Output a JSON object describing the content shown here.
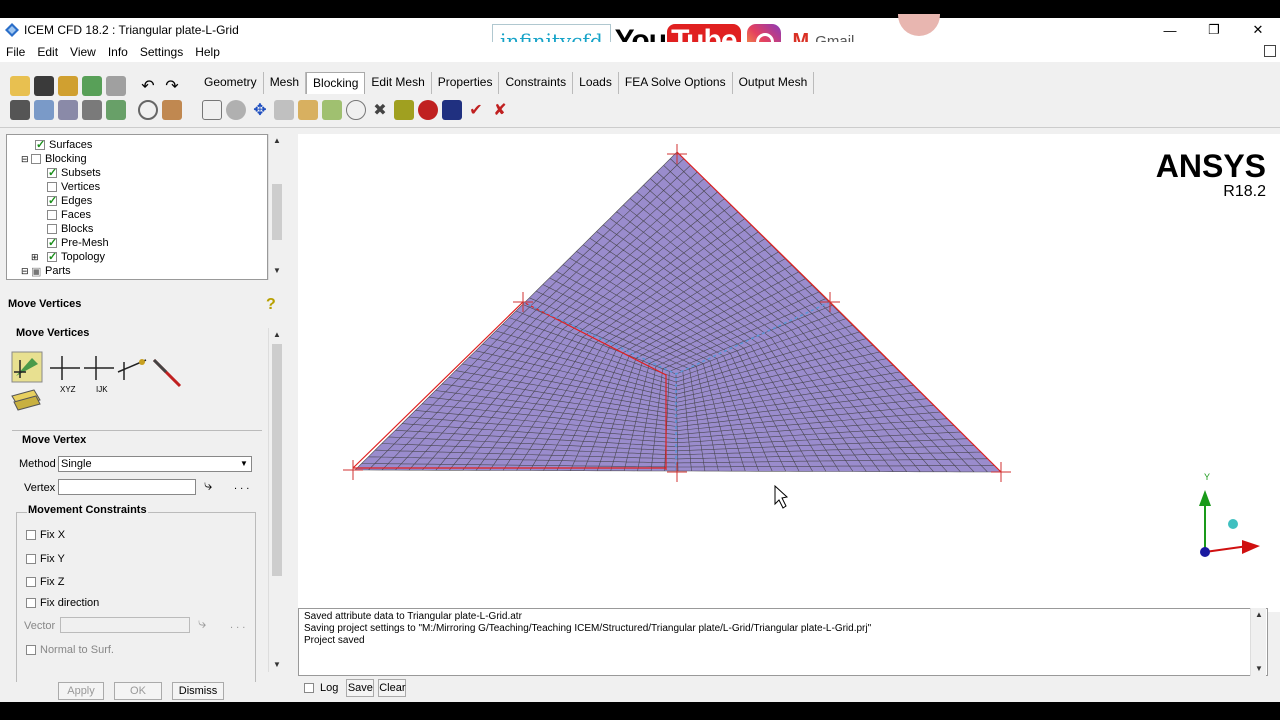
{
  "window": {
    "title": "ICEM CFD 18.2 : Triangular plate-L-Grid",
    "controls": [
      "minimize-icon",
      "restore-icon",
      "close-icon"
    ]
  },
  "branding": {
    "site": "infinitycfd",
    "youtube_you": "You",
    "youtube_tube": "Tube",
    "gmail": "Gmail"
  },
  "menu": [
    "File",
    "Edit",
    "View",
    "Info",
    "Settings",
    "Help"
  ],
  "tabs": [
    "Geometry",
    "Mesh",
    "Blocking",
    "Edit Mesh",
    "Properties",
    "Constraints",
    "Loads",
    "FEA Solve Options",
    "Output Mesh"
  ],
  "active_tab": "Blocking",
  "tree": [
    {
      "label": "Surfaces",
      "checked": true,
      "indent": 2
    },
    {
      "label": "Blocking",
      "checked": false,
      "indent": 1,
      "expander": "-"
    },
    {
      "label": "Subsets",
      "checked": true,
      "indent": 2
    },
    {
      "label": "Vertices",
      "checked": false,
      "indent": 2
    },
    {
      "label": "Edges",
      "checked": true,
      "indent": 2
    },
    {
      "label": "Faces",
      "checked": false,
      "indent": 2
    },
    {
      "label": "Blocks",
      "checked": false,
      "indent": 2
    },
    {
      "label": "Pre-Mesh",
      "checked": true,
      "indent": 2
    },
    {
      "label": "Topology",
      "checked": true,
      "indent": 2,
      "expander": "+"
    },
    {
      "label": "Parts",
      "checked": null,
      "indent": 1,
      "expander": "-"
    }
  ],
  "panel": {
    "title": "Move Vertices",
    "section": "Move Vertices",
    "tool_labels": [
      "XYZ",
      "IJK"
    ],
    "form_title": "Move Vertex",
    "method_label": "Method",
    "method_value": "Single",
    "vertex_label": "Vertex",
    "vertex_value": "",
    "constraints_title": "Movement Constraints",
    "constraints": [
      {
        "label": "Fix X",
        "checked": false
      },
      {
        "label": "Fix Y",
        "checked": false
      },
      {
        "label": "Fix Z",
        "checked": false
      },
      {
        "label": "Fix direction",
        "checked": false
      }
    ],
    "vector_label": "Vector",
    "normal_label": "Normal to Surf.",
    "buttons": {
      "apply": "Apply",
      "ok": "OK",
      "dismiss": "Dismiss"
    }
  },
  "viewport": {
    "brand": "ANSYS",
    "version": "R18.2",
    "axis_y": "Y"
  },
  "messages": [
    "Saved attribute data to Triangular plate-L-Grid.atr",
    "Saving project settings to \"M:/Mirroring G/Teaching/Teaching ICEM/Structured/Triangular plate/L-Grid/Triangular plate-L-Grid.prj\"",
    "Project saved"
  ],
  "msg_controls": {
    "log": "Log",
    "save": "Save",
    "clear": "Clear"
  },
  "colors": {
    "mesh_fill": "#9a8ccd",
    "mesh_line": "#3c3c3c",
    "edge_red": "#e02020",
    "edge_blue": "#5a96d8"
  }
}
